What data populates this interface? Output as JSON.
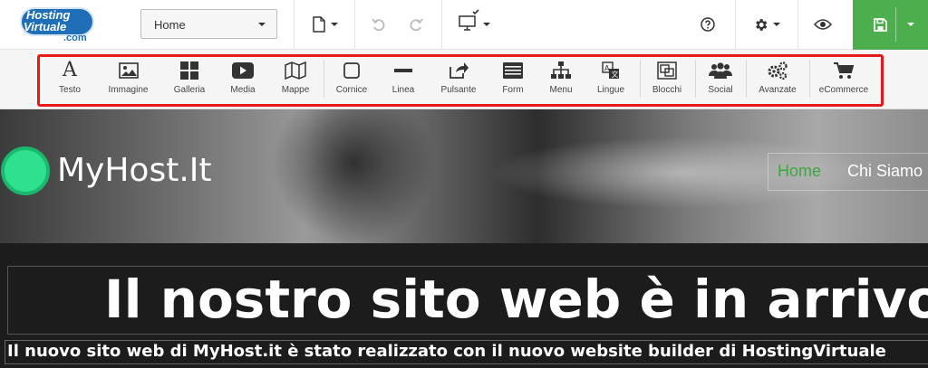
{
  "topbar": {
    "logo_line1": "Hosting",
    "logo_line2": "Virtuale",
    "logo_line3": ".com",
    "page_select_value": "Home",
    "icons": {
      "page": "file-icon",
      "undo": "undo-icon",
      "redo": "redo-icon",
      "device": "desktop-icon",
      "help": "help-icon",
      "settings": "gear-icon",
      "preview": "eye-icon",
      "save": "save-icon"
    },
    "save_color": "#4cae4c"
  },
  "toolbar": {
    "highlight_color": "#e51b1b",
    "items": [
      {
        "label": "Testo",
        "icon": "text-icon"
      },
      {
        "label": "Immagine",
        "icon": "image-icon"
      },
      {
        "label": "Galleria",
        "icon": "gallery-icon"
      },
      {
        "label": "Media",
        "icon": "video-icon"
      },
      {
        "label": "Mappe",
        "icon": "map-icon"
      },
      {
        "label": "Cornice",
        "icon": "frame-icon"
      },
      {
        "label": "Linea",
        "icon": "line-icon"
      },
      {
        "label": "Pulsante",
        "icon": "share-button-icon"
      },
      {
        "label": "Form",
        "icon": "form-icon"
      },
      {
        "label": "Menu",
        "icon": "sitemap-icon"
      },
      {
        "label": "Lingue",
        "icon": "language-icon"
      },
      {
        "label": "Blocchi",
        "icon": "blocks-icon"
      },
      {
        "label": "Social",
        "icon": "users-icon"
      },
      {
        "label": "Avanzate",
        "icon": "cogs-icon"
      },
      {
        "label": "eCommerce",
        "icon": "cart-icon"
      }
    ]
  },
  "site": {
    "brand": "MyHost.It",
    "nav": [
      "Home",
      "Chi Siamo"
    ],
    "nav_active_color": "#3ea63e",
    "headline": "Il nostro sito web è in arrivo",
    "subline": "Il nuovo sito web di MyHost.it è stato realizzato con il nuovo website builder di HostingVirtuale"
  }
}
